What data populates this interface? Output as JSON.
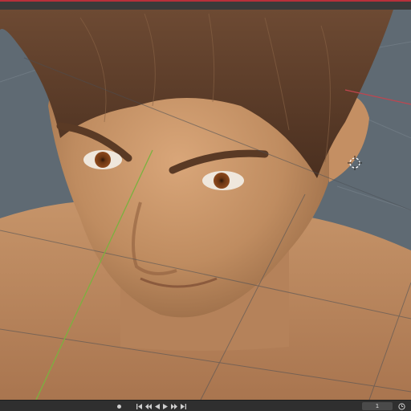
{
  "editor": {
    "current_frame": "1",
    "icons": {
      "keyframe": "keyframe-dot-icon",
      "jump_start": "jump-to-start-icon",
      "prev_keyframe": "jump-to-previous-keyframe-icon",
      "play_reverse": "play-reverse-icon",
      "play": "play-icon",
      "next_keyframe": "jump-to-next-keyframe-icon",
      "jump_end": "jump-to-end-icon",
      "clock": "clock-icon",
      "cursor_3d": "3d-cursor-icon"
    },
    "colors": {
      "accent": "#b8303a",
      "x_axis": "#c0454f",
      "y_axis": "#7bb13f",
      "viewport_bg": "#5f6a73"
    }
  }
}
